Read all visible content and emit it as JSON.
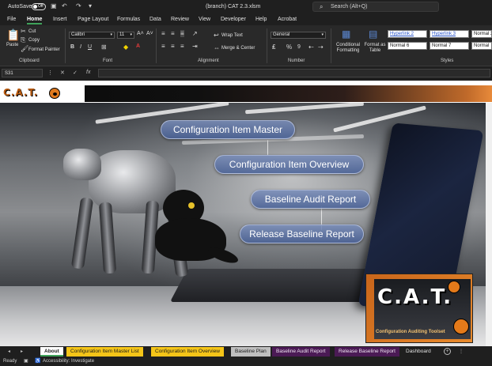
{
  "titlebar": {
    "autosave_label": "AutoSave",
    "autosave_state": "Off",
    "document_title": "(branch) CAT 2.3.xlsm",
    "search_placeholder": "Search (Alt+Q)"
  },
  "menu": {
    "tabs": [
      "File",
      "Home",
      "Insert",
      "Page Layout",
      "Formulas",
      "Data",
      "Review",
      "View",
      "Developer",
      "Help",
      "Acrobat"
    ],
    "active": "Home"
  },
  "ribbon": {
    "clipboard": {
      "label": "Clipboard",
      "paste": "Paste",
      "cut": "Cut",
      "copy": "Copy",
      "format_painter": "Format Painter"
    },
    "font": {
      "label": "Font",
      "family": "Calibri",
      "size": "11"
    },
    "alignment": {
      "label": "Alignment",
      "wrap_text": "Wrap Text",
      "merge_center": "Merge & Center"
    },
    "number": {
      "label": "Number",
      "format": "General"
    },
    "styles": {
      "label": "Styles",
      "conditional_formatting": "Conditional Formatting",
      "format_as_table": "Format as Table",
      "cells": [
        {
          "text": "Hyperlink 2",
          "kind": "link"
        },
        {
          "text": "Hyperlink 3",
          "kind": "link"
        },
        {
          "text": "Normal 2",
          "kind": "normal"
        },
        {
          "text": "Normal 6",
          "kind": "normal"
        },
        {
          "text": "Normal 7",
          "kind": "normal"
        },
        {
          "text": "Normal",
          "kind": "normal"
        }
      ]
    }
  },
  "formula_bar": {
    "name_box": "S31",
    "fx": "fx",
    "formula": ""
  },
  "sheet": {
    "logo_text": "C.A.T.",
    "buttons": [
      "Configuration Item Master",
      "Configuration Item Overview",
      "Baseline Audit Report",
      "Release Baseline Report"
    ],
    "badge_title": "C.A.T.",
    "badge_subtitle": "Configuration Auditing Toolset"
  },
  "sheet_tabs": [
    {
      "label": "About",
      "style": "about"
    },
    {
      "label": "Configuration Item Master List",
      "style": "yellow"
    },
    {
      "label": "Configuration Item Overview",
      "style": "yellow"
    },
    {
      "label": "Baseline Plan",
      "style": "gray"
    },
    {
      "label": "Baseline Audit Report",
      "style": "purple"
    },
    {
      "label": "Release Baseline Report",
      "style": "purple"
    },
    {
      "label": "Dashboard",
      "style": "dark"
    }
  ],
  "status": {
    "ready": "Ready",
    "accessibility": "Accessibility: Investigate"
  },
  "colors": {
    "accent_green": "#3fa35a",
    "tab_yellow": "#f5c518",
    "tab_purple": "#4b1a55",
    "brand_orange": "#e07a1e"
  }
}
